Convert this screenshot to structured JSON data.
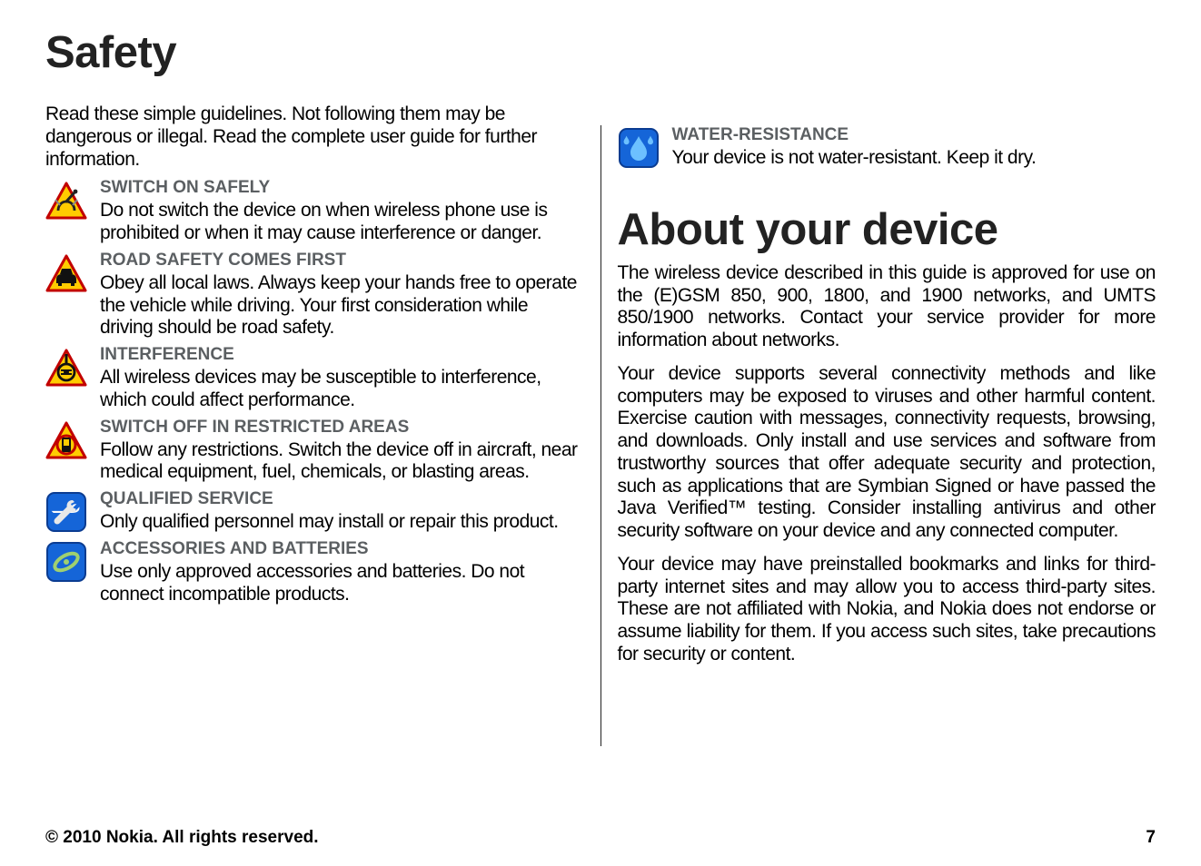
{
  "safety": {
    "heading": "Safety",
    "intro": "Read these simple guidelines. Not following them may be dangerous or illegal. Read the complete user guide for further information.",
    "items": [
      {
        "icon": "switch-on",
        "title": "SWITCH ON SAFELY",
        "body": "Do not switch the device on when wireless phone use is prohibited or when it may cause interference or danger."
      },
      {
        "icon": "road-safety",
        "title": "ROAD SAFETY COMES FIRST",
        "body": "Obey all local laws. Always keep your hands free to operate the vehicle while driving. Your first consideration while driving should be road safety."
      },
      {
        "icon": "interference",
        "title": "INTERFERENCE",
        "body": "All wireless devices may be susceptible to interference, which could affect performance."
      },
      {
        "icon": "switch-off",
        "title": "SWITCH OFF IN RESTRICTED AREAS",
        "body": "Follow any restrictions. Switch the device off in aircraft, near medical equipment, fuel, chemicals, or blasting areas."
      },
      {
        "icon": "qualified-service",
        "title": "QUALIFIED SERVICE",
        "body": "Only qualified personnel may install or repair this product."
      },
      {
        "icon": "accessories",
        "title": "ACCESSORIES AND BATTERIES",
        "body": "Use only approved accessories and batteries. Do not connect incompatible products."
      }
    ]
  },
  "water": {
    "icon": "water-resistance",
    "title": "WATER-RESISTANCE",
    "body": "Your device is not water-resistant. Keep it dry."
  },
  "about": {
    "heading": "About your device",
    "paragraphs": [
      "The wireless device described in this guide is approved for use on the (E)GSM 850, 900, 1800, and 1900 networks, and UMTS 850/1900 networks. Contact your service provider for more information about networks.",
      "Your device supports several connectivity methods and like computers may be exposed to viruses and other harmful content. Exercise caution with messages, connectivity requests, browsing, and downloads. Only install and use services and software from trustworthy sources that offer adequate security and protection, such as applications that are Symbian Signed or have passed the Java Verified™ testing. Consider installing antivirus and other security software on your device and any connected computer.",
      "Your device may have preinstalled bookmarks and links for third-party internet sites and may allow you to access third-party sites. These are not affiliated with Nokia, and Nokia does not endorse or assume liability for them. If you access such sites, take precautions for security or content."
    ]
  },
  "footer": {
    "copyright": "© 2010 Nokia. All rights reserved.",
    "page_number": "7"
  }
}
